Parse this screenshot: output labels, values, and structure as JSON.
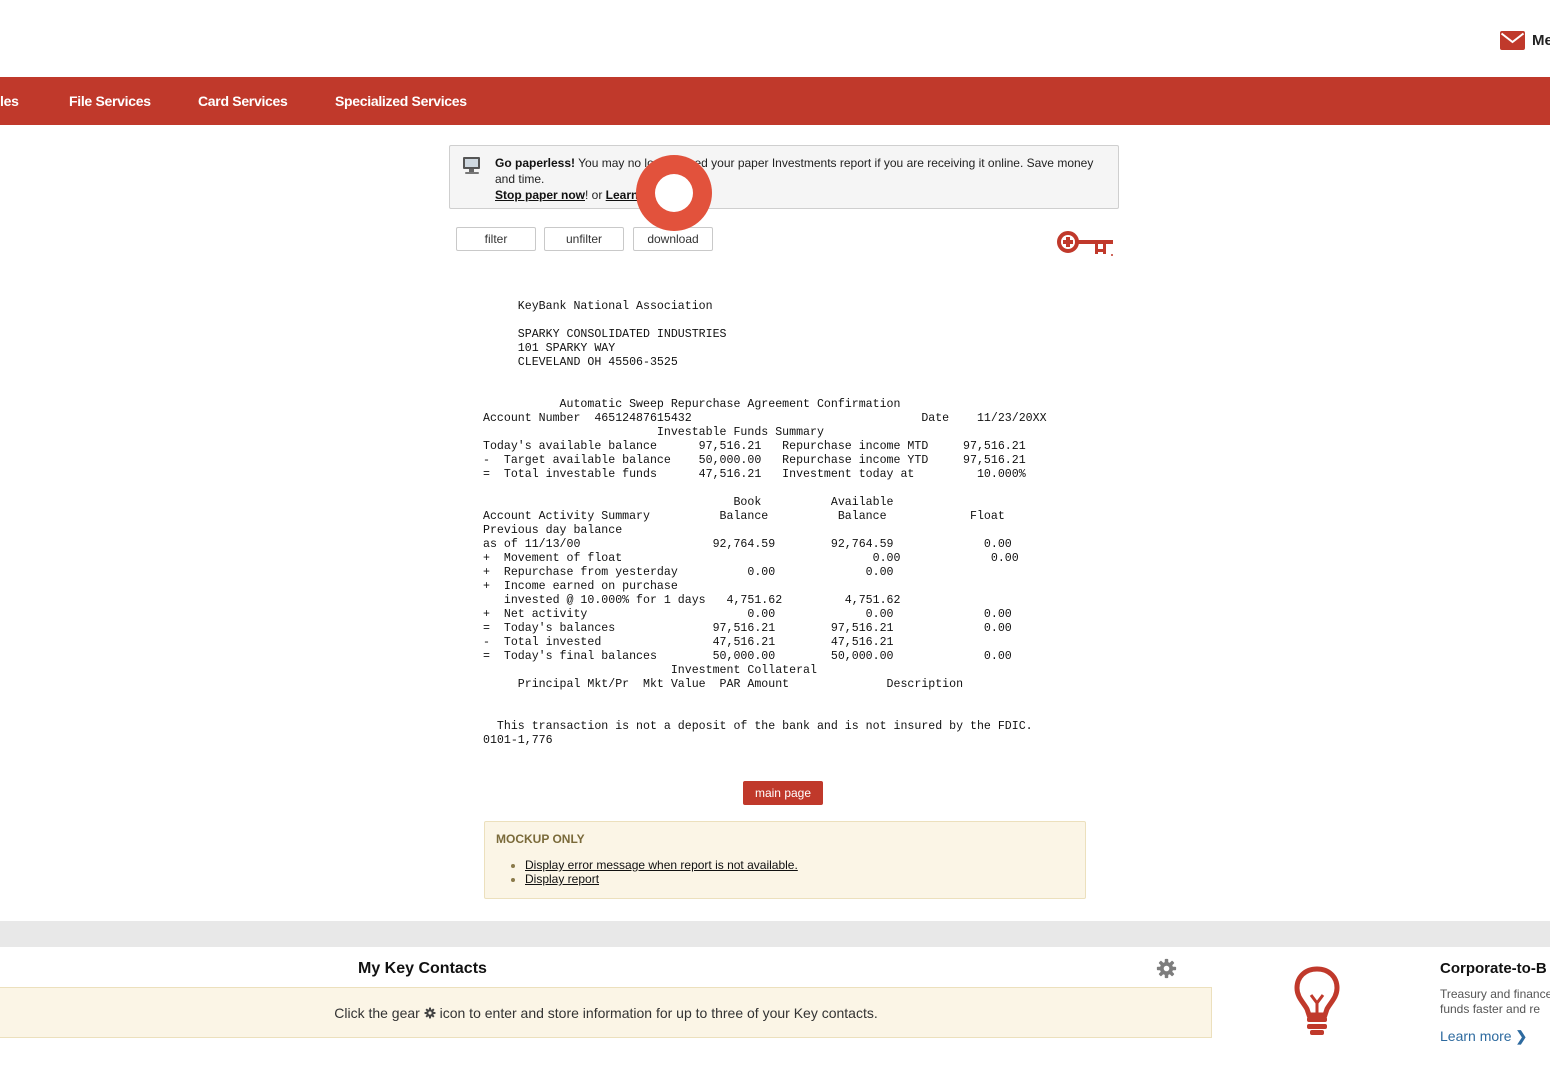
{
  "header": {
    "mail_label": "Me"
  },
  "nav": {
    "items": [
      {
        "label": "les"
      },
      {
        "label": "File Services"
      },
      {
        "label": "Card Services"
      },
      {
        "label": "Specialized Services"
      }
    ]
  },
  "paperless": {
    "bold_lead": "Go paperless!",
    "message": " You may no longer need your paper Investments report if you are receiving it online. Save money and time.",
    "stop_link": "Stop paper now",
    "between": "! or ",
    "learn_link": "Learn more"
  },
  "toolbar": {
    "filter_label": "filter",
    "unfilter_label": "unfilter",
    "download_label": "download"
  },
  "report": {
    "lines": [
      "     KeyBank National Association",
      "",
      "     SPARKY CONSOLIDATED INDUSTRIES",
      "     101 SPARKY WAY",
      "     CLEVELAND OH 45506-3525",
      "",
      "",
      "           Automatic Sweep Repurchase Agreement Confirmation",
      "Account Number  46512487615432                                 Date    11/23/20XX",
      "                         Investable Funds Summary",
      "Today's available balance      97,516.21   Repurchase income MTD     97,516.21",
      "-  Target available balance    50,000.00   Repurchase income YTD     97,516.21",
      "=  Total investable funds      47,516.21   Investment today at         10.000%",
      "",
      "                                    Book          Available",
      "Account Activity Summary          Balance          Balance            Float",
      "Previous day balance",
      "as of 11/13/00                   92,764.59        92,764.59             0.00",
      "+  Movement of float                                    0.00             0.00",
      "+  Repurchase from yesterday          0.00             0.00",
      "+  Income earned on purchase",
      "   invested @ 10.000% for 1 days   4,751.62         4,751.62",
      "+  Net activity                       0.00             0.00             0.00",
      "=  Today's balances              97,516.21        97,516.21             0.00",
      "-  Total invested                47,516.21        47,516.21",
      "=  Today's final balances        50,000.00        50,000.00             0.00",
      "                           Investment Collateral",
      "     Principal Mkt/Pr  Mkt Value  PAR Amount              Description",
      "",
      "",
      "  This transaction is not a deposit of the bank and is not insured by the FDIC.",
      "0101-1,776"
    ]
  },
  "main_button_label": "main page",
  "mockup": {
    "title": "MOCKUP ONLY",
    "items": [
      {
        "label": "Display error message when report is not available."
      },
      {
        "label": "Display report"
      }
    ]
  },
  "contacts": {
    "title": "My Key Contacts",
    "msg_before": "Click the gear ",
    "msg_after": " icon to enter and store information for up to three of your Key contacts."
  },
  "promo": {
    "title": "Corporate-to-B",
    "desc_line1": "Treasury and finance",
    "desc_line2": "funds faster and re",
    "learn_more": "Learn more"
  },
  "colors": {
    "brand_red": "#c0392b",
    "tap_indicator": "#e04932",
    "notice_bg": "#fbf5e6",
    "link_blue": "#2d6a9f"
  }
}
